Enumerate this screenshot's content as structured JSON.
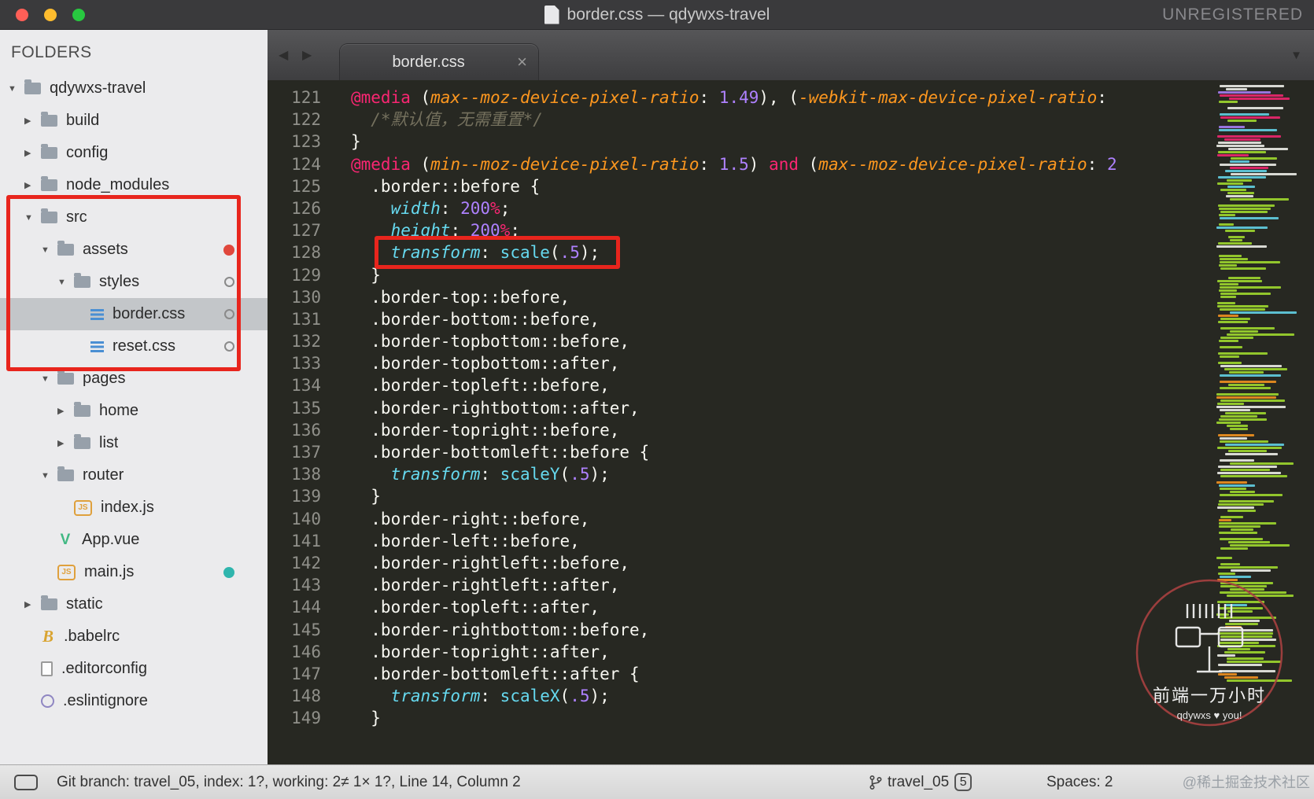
{
  "window": {
    "title": "border.css — qdywxs-travel",
    "unregistered": "UNREGISTERED"
  },
  "sidebar": {
    "header": "FOLDERS",
    "items": [
      {
        "label": "qdywxs-travel",
        "icon": "folder",
        "arrow": "exp",
        "depth": 0
      },
      {
        "label": "build",
        "icon": "folder",
        "arrow": "col",
        "depth": 1
      },
      {
        "label": "config",
        "icon": "folder",
        "arrow": "col",
        "depth": 1
      },
      {
        "label": "node_modules",
        "icon": "folder",
        "arrow": "col",
        "depth": 1
      },
      {
        "label": "src",
        "icon": "folder",
        "arrow": "exp",
        "depth": 1
      },
      {
        "label": "assets",
        "icon": "folder",
        "arrow": "exp",
        "depth": 2,
        "status": "red"
      },
      {
        "label": "styles",
        "icon": "folder",
        "arrow": "exp",
        "depth": 3,
        "status": "ring"
      },
      {
        "label": "border.css",
        "icon": "css",
        "arrow": "none",
        "depth": 4,
        "status": "ring",
        "selected": true
      },
      {
        "label": "reset.css",
        "icon": "css",
        "arrow": "none",
        "depth": 4,
        "status": "ring"
      },
      {
        "label": "pages",
        "icon": "folder",
        "arrow": "exp",
        "depth": 2
      },
      {
        "label": "home",
        "icon": "folder",
        "arrow": "col",
        "depth": 3
      },
      {
        "label": "list",
        "icon": "folder",
        "arrow": "col",
        "depth": 3
      },
      {
        "label": "router",
        "icon": "folder",
        "arrow": "exp",
        "depth": 2
      },
      {
        "label": "index.js",
        "icon": "js",
        "arrow": "none",
        "depth": 3
      },
      {
        "label": "App.vue",
        "icon": "vue",
        "arrow": "none",
        "depth": 2
      },
      {
        "label": "main.js",
        "icon": "js",
        "arrow": "none",
        "depth": 2,
        "status": "teal"
      },
      {
        "label": "static",
        "icon": "folder",
        "arrow": "col",
        "depth": 1
      },
      {
        "label": ".babelrc",
        "icon": "babel",
        "arrow": "none",
        "depth": 1
      },
      {
        "label": ".editorconfig",
        "icon": "doc",
        "arrow": "none",
        "depth": 1
      },
      {
        "label": ".eslintignore",
        "icon": "eslint",
        "arrow": "none",
        "depth": 1
      }
    ]
  },
  "tab": {
    "label": "border.css",
    "close": "×"
  },
  "editor": {
    "first_line": 121,
    "lines": [
      [
        [
          "k",
          "@media"
        ],
        [
          "p",
          " ("
        ],
        [
          "param",
          "max--moz-device-pixel-ratio"
        ],
        [
          "p",
          ":"
        ],
        [
          "num",
          " 1.49"
        ],
        [
          "p",
          "), ("
        ],
        [
          "param",
          "-webkit-max-device-pixel-ratio"
        ],
        [
          "p",
          ":"
        ]
      ],
      [
        [
          "com",
          "  /*默认值，无需重置*/"
        ]
      ],
      [
        [
          "p",
          "}"
        ]
      ],
      [
        [
          "k",
          "@media"
        ],
        [
          "p",
          " ("
        ],
        [
          "param",
          "min--moz-device-pixel-ratio"
        ],
        [
          "p",
          ":"
        ],
        [
          "num",
          " 1.5"
        ],
        [
          "p",
          ") "
        ],
        [
          "k",
          "and"
        ],
        [
          "p",
          " ("
        ],
        [
          "param",
          "max--moz-device-pixel-ratio"
        ],
        [
          "p",
          ":"
        ],
        [
          "num",
          " 2"
        ]
      ],
      [
        [
          "p",
          "  .border::before {"
        ]
      ],
      [
        [
          "p",
          "    "
        ],
        [
          "prop",
          "width"
        ],
        [
          "p",
          ": "
        ],
        [
          "num",
          "200"
        ],
        [
          "pct",
          "%"
        ],
        [
          "p",
          ";"
        ]
      ],
      [
        [
          "p",
          "    "
        ],
        [
          "prop",
          "height"
        ],
        [
          "p",
          ": "
        ],
        [
          "num",
          "200"
        ],
        [
          "pct",
          "%"
        ],
        [
          "p",
          ";"
        ]
      ],
      [
        [
          "p",
          "    "
        ],
        [
          "prop",
          "transform"
        ],
        [
          "p",
          ": "
        ],
        [
          "fn",
          "scale"
        ],
        [
          "p",
          "("
        ],
        [
          "num",
          ".5"
        ],
        [
          "p",
          ");"
        ]
      ],
      [
        [
          "p",
          "  }"
        ]
      ],
      [
        [
          "p",
          "  .border-top::before,"
        ]
      ],
      [
        [
          "p",
          "  .border-bottom::before,"
        ]
      ],
      [
        [
          "p",
          "  .border-topbottom::before,"
        ]
      ],
      [
        [
          "p",
          "  .border-topbottom::after,"
        ]
      ],
      [
        [
          "p",
          "  .border-topleft::before,"
        ]
      ],
      [
        [
          "p",
          "  .border-rightbottom::after,"
        ]
      ],
      [
        [
          "p",
          "  .border-topright::before,"
        ]
      ],
      [
        [
          "p",
          "  .border-bottomleft::before {"
        ]
      ],
      [
        [
          "p",
          "    "
        ],
        [
          "prop",
          "transform"
        ],
        [
          "p",
          ": "
        ],
        [
          "fn",
          "scaleY"
        ],
        [
          "p",
          "("
        ],
        [
          "num",
          ".5"
        ],
        [
          "p",
          ");"
        ]
      ],
      [
        [
          "p",
          "  }"
        ]
      ],
      [
        [
          "p",
          "  .border-right::before,"
        ]
      ],
      [
        [
          "p",
          "  .border-left::before,"
        ]
      ],
      [
        [
          "p",
          "  .border-rightleft::before,"
        ]
      ],
      [
        [
          "p",
          "  .border-rightleft::after,"
        ]
      ],
      [
        [
          "p",
          "  .border-topleft::after,"
        ]
      ],
      [
        [
          "p",
          "  .border-rightbottom::before,"
        ]
      ],
      [
        [
          "p",
          "  .border-topright::after,"
        ]
      ],
      [
        [
          "p",
          "  .border-bottomleft::after {"
        ]
      ],
      [
        [
          "p",
          "    "
        ],
        [
          "prop",
          "transform"
        ],
        [
          "p",
          ": "
        ],
        [
          "fn",
          "scaleX"
        ],
        [
          "p",
          "("
        ],
        [
          "num",
          ".5"
        ],
        [
          "p",
          ");"
        ]
      ],
      [
        [
          "p",
          "  }"
        ]
      ]
    ]
  },
  "status_bar": {
    "left_text": "Git branch: travel_05, index: 1?, working: 2≠ 1× 1?, Line 14, Column 2",
    "branch": "travel_05",
    "branch_badge": "5",
    "spaces": "Spaces: 2"
  },
  "watermark": {
    "title": "前端一万小时",
    "subtitle": "qdywxs ♥ you!",
    "corner": "@稀土掘金技术社区"
  },
  "colors": {
    "annotation_red": "#e8251d",
    "status_red_dot": "#e0473c",
    "status_teal_dot": "#2fb5ad",
    "accent_pink": "#f92672",
    "accent_cyan": "#66d9ef",
    "accent_purple": "#ae81ff",
    "accent_orange": "#fd971f",
    "accent_green": "#a6e22e",
    "editor_bg": "#272822"
  }
}
